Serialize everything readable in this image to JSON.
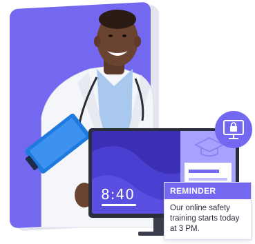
{
  "colors": {
    "accent": "#7467f0",
    "accent_light": "#a8a2ff",
    "monitor_screen": "#3a2fb5",
    "white": "#ffffff"
  },
  "monitor": {
    "time": "8:40"
  },
  "reminder": {
    "title": "REMINDER",
    "message": "Our online safety training starts today at 3 PM."
  },
  "icons": {
    "lock_monitor": "lock-monitor-icon",
    "graduation_cap": "graduation-cap-icon"
  }
}
